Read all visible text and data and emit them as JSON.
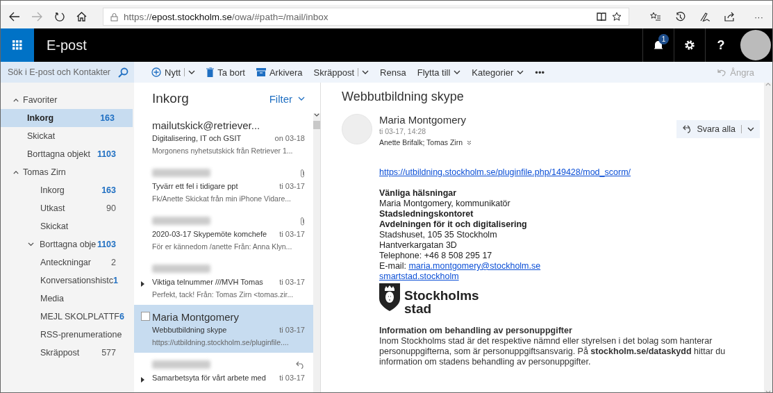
{
  "browser": {
    "url_prefix": "https://",
    "url_host": "epost.stockholm.se",
    "url_path": "/owa/#path=/mail/inbox",
    "more": "···"
  },
  "app": {
    "title": "E-post",
    "notification_count": "1",
    "help": "?"
  },
  "search": {
    "placeholder": "Sök i E-post och Kontakter"
  },
  "toolbar": [
    {
      "label": "Nytt",
      "kind": "new",
      "dropdown": true,
      "split": true
    },
    {
      "label": "Ta bort",
      "kind": "delete",
      "dropdown": false,
      "split": false
    },
    {
      "label": "Arkivera",
      "kind": "archive",
      "dropdown": false,
      "split": false
    },
    {
      "label": "Skräppost",
      "kind": "plain",
      "dropdown": true,
      "split": true
    },
    {
      "label": "Rensa",
      "kind": "plain",
      "dropdown": false,
      "split": false
    },
    {
      "label": "Flytta till",
      "kind": "plain",
      "dropdown": true,
      "split": false
    },
    {
      "label": "Kategorier",
      "kind": "plain",
      "dropdown": true,
      "split": false
    },
    {
      "label": "•••",
      "kind": "plain",
      "dropdown": false,
      "split": false
    }
  ],
  "undo": {
    "label": "Ångra",
    "disabled": true
  },
  "folders": [
    {
      "label": "Favoriter",
      "expanded": true,
      "children": [
        {
          "label": "Inkorg",
          "count": "163",
          "unread": true,
          "selected": true
        },
        {
          "label": "Skickat",
          "selected": false
        },
        {
          "label": "Borttagna objekt",
          "count": "1103",
          "unread": true,
          "selected": false
        }
      ]
    },
    {
      "label": "Tomas Zirn",
      "expanded": true,
      "children": [
        {
          "label": "Inkorg",
          "count": "163",
          "unread": true,
          "selected": false
        },
        {
          "label": "Utkast",
          "count": "90",
          "unread": false,
          "selected": false
        },
        {
          "label": "Skickat",
          "selected": false
        },
        {
          "label": "Borttagna obje",
          "count": "1103",
          "unread": true,
          "selected": false,
          "has_subfolders": true
        },
        {
          "label": "Anteckningar",
          "count": "2",
          "unread": false,
          "selected": false
        },
        {
          "label": "Konversationshistc",
          "count": "1",
          "unread": true,
          "selected": false
        },
        {
          "label": "Media",
          "selected": false
        },
        {
          "label": "MEJL SKOLPLATTF",
          "count": "6",
          "unread": true,
          "selected": false
        },
        {
          "label": "RSS-prenumeratione",
          "selected": false
        },
        {
          "label": "Skräppost",
          "count": "577",
          "unread": false,
          "selected": false
        }
      ]
    }
  ],
  "list": {
    "title": "Inkorg",
    "filter": "Filter",
    "messages": [
      {
        "sender": "mailutskick@retriever...",
        "subject": "Digitalisering, IT och GSIT",
        "date": "on 03-18",
        "preview": "Morgonens nyhetsutskick från Retriever 1...",
        "selected": false,
        "attachment": false,
        "replied": false,
        "thread": false,
        "sender_blurred": false
      },
      {
        "subject": "Tyvärr ett fel i tidigare ppt",
        "date": "ti 03-17",
        "preview": "Fk/Anette Skickat från min iPhone Vidare...",
        "selected": false,
        "attachment": true,
        "replied": false,
        "thread": false,
        "sender_blurred": true
      },
      {
        "subject": "2020-03-17 Skypemöte komchefe",
        "date": "ti 03-17",
        "preview": "För er kännedom /anette Från: Anna Klyn...",
        "selected": false,
        "attachment": true,
        "replied": false,
        "thread": false,
        "sender_blurred": true
      },
      {
        "subject": "Viktiga telnummer ///MVH Tomas",
        "date": "ti 03-17",
        "preview": "Perfekt, tack! Från: Tomas Zirn <tomas.zir...",
        "selected": false,
        "attachment": false,
        "replied": false,
        "thread": true,
        "sender_blurred": true
      },
      {
        "sender": "Maria Montgomery",
        "subject": "Webbutbildning skype",
        "date": "ti 03-17",
        "preview": "https://utbildning.stockholm.se/pluginfile....",
        "selected": true,
        "attachment": false,
        "replied": false,
        "thread": false,
        "sender_blurred": false
      },
      {
        "subject": "Samarbetsyta för vårt arbete med",
        "date": "ti 03-17",
        "selected": false,
        "attachment": false,
        "replied": true,
        "thread": true,
        "sender_blurred": true
      }
    ]
  },
  "reading": {
    "subject": "Webbutbildning skype",
    "sender": "Maria Montgomery",
    "sent": "ti 03-17, 14:28",
    "recipients": "Anette Brifalk; Tomas Zirn",
    "reply_all": "Svara alla",
    "body": [
      {
        "kind": "link",
        "text": "https://utbildning.stockholm.se/pluginfile.php/149428/mod_scorm/"
      },
      {
        "kind": "gap"
      },
      {
        "kind": "bold",
        "text": "Vänliga hälsningar"
      },
      {
        "kind": "text",
        "text": "Maria Montgomery, kommunikatör"
      },
      {
        "kind": "bold",
        "text": "Stadsledningskontoret"
      },
      {
        "kind": "bold",
        "text": "Avdelningen för it och digitalisering"
      },
      {
        "kind": "text",
        "text": "Stadshuset, 105 35 Stockholm"
      },
      {
        "kind": "text",
        "text": "Hantverkargatan 3D"
      },
      {
        "kind": "text",
        "text": "Telephone: +46 8 508 295 17"
      },
      {
        "kind": "labeled_link",
        "text": "E-mail: ",
        "link": "maria.montgomery@stockholm.se"
      },
      {
        "kind": "link",
        "text": "smartstad.stockholm"
      },
      {
        "kind": "logo",
        "line1": "Stockholms",
        "line2": "stad"
      },
      {
        "kind": "gap"
      },
      {
        "kind": "heading",
        "text": "Information om behandling av personuppgifter"
      },
      {
        "kind": "paragraph",
        "text": "Inom Stockholms stad är det respektive nämnd eller styrelsen i det bolag som hanterar personuppgifterna, som är personuppgiftsansvarig. På **stockholm.se/dataskydd** hittar du information om stadens behandling av personuppgifter."
      }
    ]
  }
}
